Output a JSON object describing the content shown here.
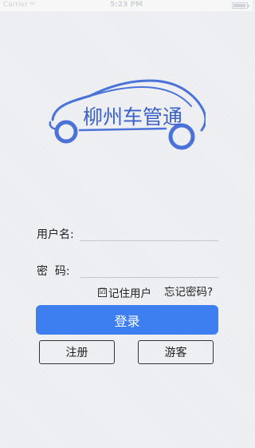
{
  "status_bar": {
    "carrier": "Carrier",
    "wifi_icon": "wifi-icon",
    "time": "5:23 PM",
    "battery_icon": "battery-icon"
  },
  "logo": {
    "text": "柳州车管通",
    "color": "#4a72d9"
  },
  "form": {
    "username_label": "用户名:",
    "username_value": "",
    "password_label": "密  码:",
    "password_value": "",
    "remember_check": "☑",
    "remember_label": "记住用户",
    "forgot_label": "忘记密码?"
  },
  "buttons": {
    "login": "登录",
    "register": "注册",
    "guest": "游客"
  },
  "colors": {
    "accent": "#3d7ef0",
    "background": "#ebedf0"
  }
}
